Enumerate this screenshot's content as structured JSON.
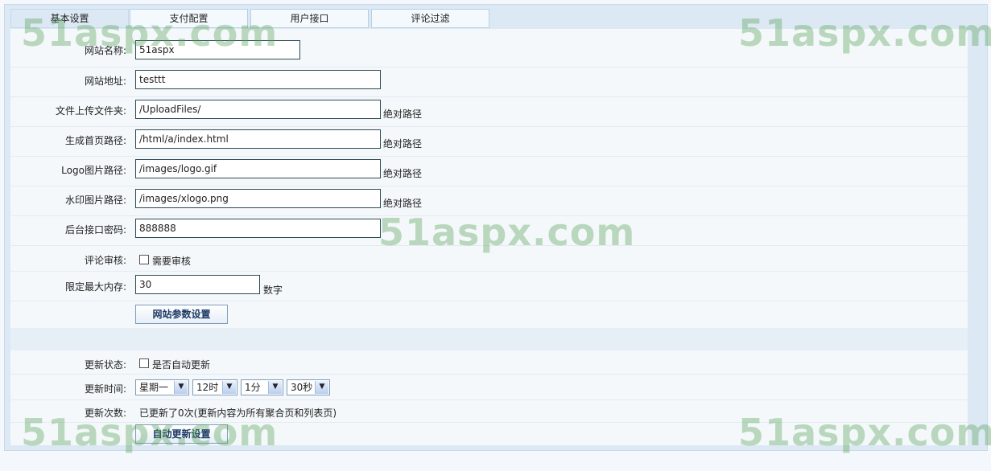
{
  "tabs": [
    {
      "label": "基本设置",
      "active": true
    },
    {
      "label": "支付配置",
      "active": false
    },
    {
      "label": "用户接口",
      "active": false
    },
    {
      "label": "评论过滤",
      "active": false
    }
  ],
  "site_settings": {
    "site_name": {
      "label": "网站名称:",
      "value": "51aspx"
    },
    "site_url": {
      "label": "网站地址:",
      "value": "testtt"
    },
    "upload_folder": {
      "label": "文件上传文件夹:",
      "value": "/UploadFiles/",
      "suffix": "绝对路径"
    },
    "index_path": {
      "label": "生成首页路径:",
      "value": "/html/a/index.html",
      "suffix": "绝对路径"
    },
    "logo_path": {
      "label": "Logo图片路径:",
      "value": "/images/logo.gif",
      "suffix": "绝对路径"
    },
    "watermark_path": {
      "label": "水印图片路径:",
      "value": "/images/xlogo.png",
      "suffix": "绝对路径"
    },
    "admin_password": {
      "label": "后台接口密码:",
      "value": "888888"
    },
    "comment_review": {
      "label": "评论审核:",
      "checkbox_label": "需要审核",
      "checked": false
    },
    "max_memory": {
      "label": "限定最大内存:",
      "value": "30",
      "suffix": "数字"
    },
    "submit_label": "网站参数设置"
  },
  "auto_update": {
    "status": {
      "label": "更新状态:",
      "checkbox_label": "是否自动更新",
      "checked": false
    },
    "time": {
      "label": "更新时间:",
      "weekday": "星期一",
      "hour": "12时",
      "minute": "1分",
      "second": "30秒"
    },
    "count": {
      "label": "更新次数:",
      "text": "已更新了0次(更新内容为所有聚合页和列表页)"
    },
    "submit_label": "自动更新设置"
  },
  "watermark_text": "51aspx.com",
  "colors": {
    "accent": "#1c3a66",
    "watermark": "#56a056"
  }
}
